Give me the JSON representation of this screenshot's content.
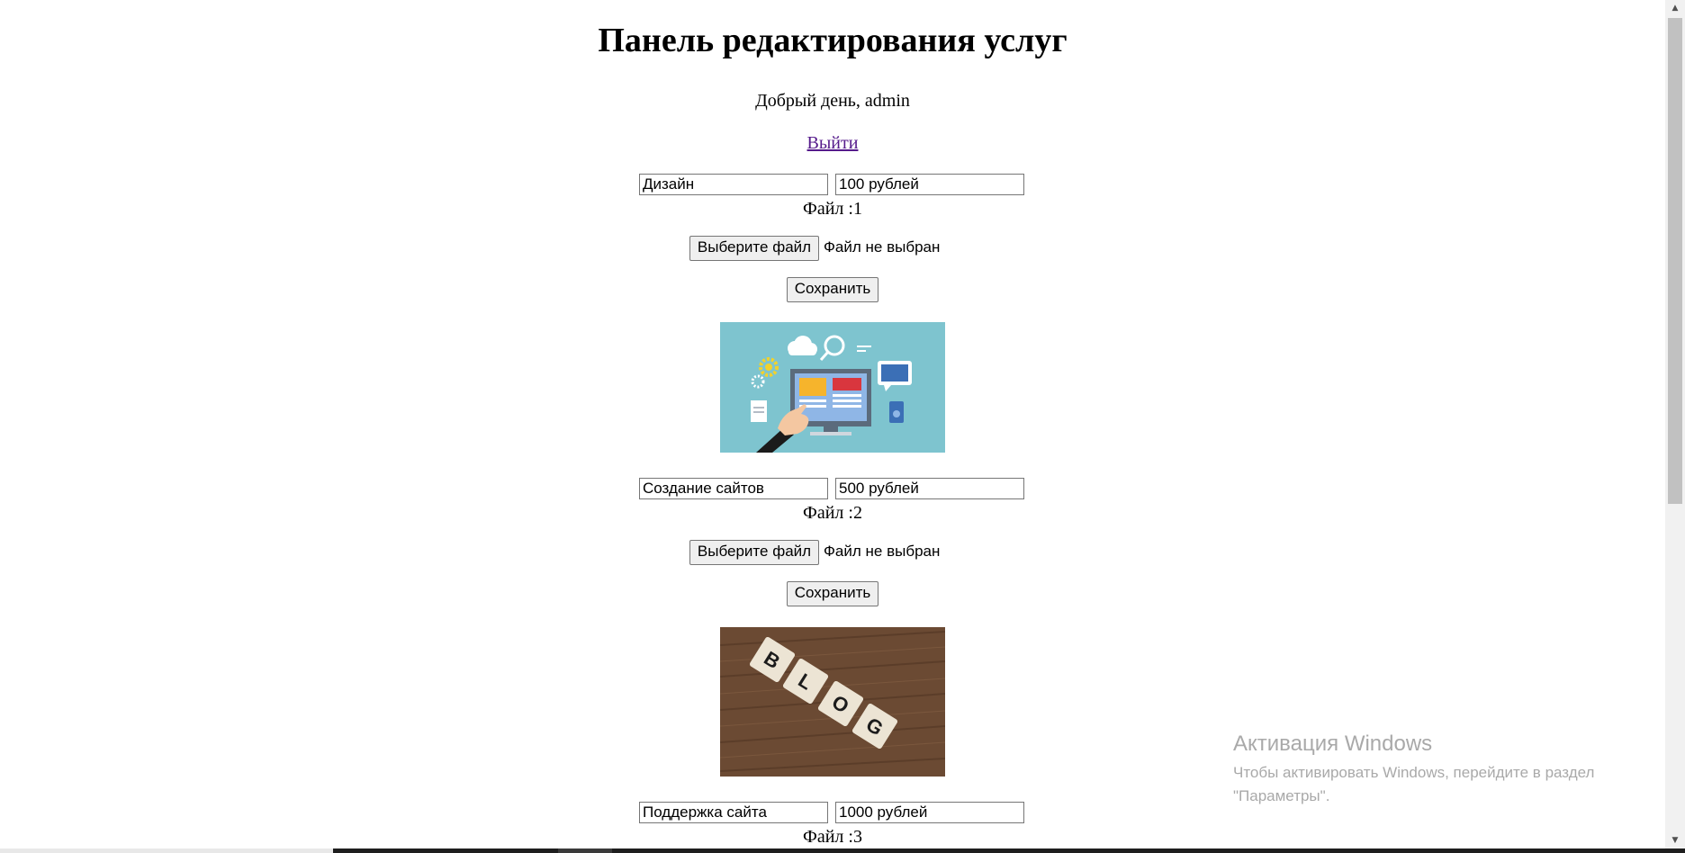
{
  "page": {
    "title": "Панель редактирования услуг",
    "greeting": "Добрый день, admin",
    "logout_label": "Выйти"
  },
  "services": [
    {
      "name": "Дизайн",
      "price": "100 рублей",
      "file_label": "Файл :1",
      "choose_file_label": "Выберите файл",
      "file_status": "Файл не выбран",
      "save_label": "Сохранить",
      "image": "web-design-illustration"
    },
    {
      "name": "Создание сайтов",
      "price": "500 рублей",
      "file_label": "Файл :2",
      "choose_file_label": "Выберите файл",
      "file_status": "Файл не выбран",
      "save_label": "Сохранить",
      "image": "blog-tiles-photo"
    },
    {
      "name": "Поддержка сайта",
      "price": "1000 рублей",
      "file_label": "Файл :3"
    }
  ],
  "watermark": {
    "title": "Активация Windows",
    "subtitle": "Чтобы активировать Windows, перейдите в раздел \"Параметры\"."
  },
  "colors": {
    "link": "#551a8b",
    "image1_bg": "#7ec4cf",
    "image2_wood": "#6b4a33"
  }
}
